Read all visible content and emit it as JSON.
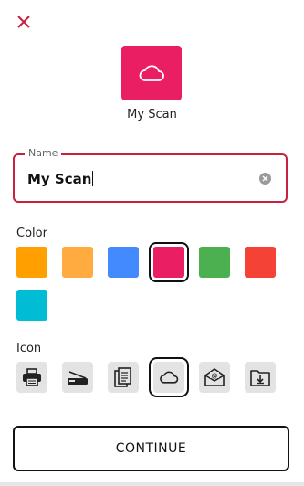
{
  "header": {
    "close_icon": "close-icon",
    "accent": "#c8203f"
  },
  "preview": {
    "name": "My Scan",
    "color": "#e91e63",
    "icon": "cloud-icon"
  },
  "name_field": {
    "label": "Name",
    "value": "My Scan",
    "clear_icon": "clear-icon"
  },
  "color_section": {
    "label": "Color",
    "swatches": [
      {
        "color": "#ffa000",
        "selected": false
      },
      {
        "color": "#ffab40",
        "selected": false
      },
      {
        "color": "#448aff",
        "selected": false
      },
      {
        "color": "#e91e63",
        "selected": true
      },
      {
        "color": "#4caf50",
        "selected": false
      },
      {
        "color": "#f44336",
        "selected": false
      },
      {
        "color": "#00bcd4",
        "selected": false
      }
    ]
  },
  "icon_section": {
    "label": "Icon",
    "icons": [
      {
        "name": "printer-icon",
        "selected": false
      },
      {
        "name": "scanner-icon",
        "selected": false
      },
      {
        "name": "documents-icon",
        "selected": false
      },
      {
        "name": "cloud-icon",
        "selected": true
      },
      {
        "name": "email-icon",
        "selected": false
      },
      {
        "name": "folder-download-icon",
        "selected": false
      }
    ]
  },
  "actions": {
    "continue_label": "CONTINUE"
  }
}
